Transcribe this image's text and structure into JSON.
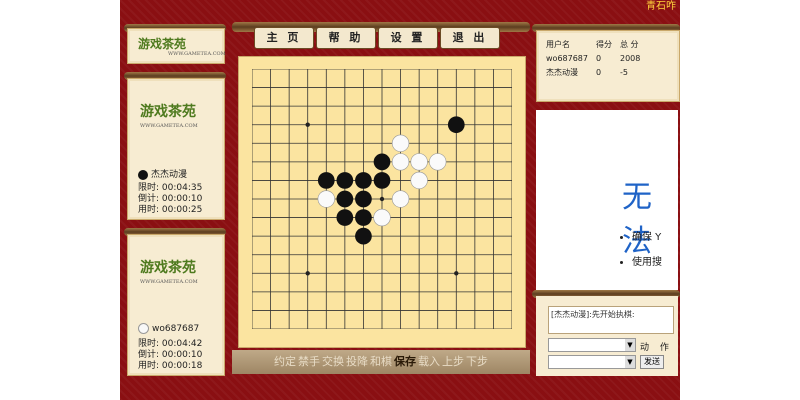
{
  "topbar": {
    "btn_label": "青石咋"
  },
  "menu": {
    "items": [
      "主 页",
      "帮 助",
      "设 置",
      "退 出"
    ]
  },
  "logo": {
    "text": "游戏茶苑",
    "sub": "WWW.GAMETEA.COM"
  },
  "players": [
    {
      "name": "杰杰动漫",
      "stone": "black",
      "limit_label": "限时:",
      "limit": "00:04:35",
      "count_label": "倒计:",
      "count": "00:00:10",
      "used_label": "用时:",
      "used": "00:00:25"
    },
    {
      "name": "wo687687",
      "stone": "white",
      "limit_label": "限时:",
      "limit": "00:04:42",
      "count_label": "倒计:",
      "count": "00:00:10",
      "used_label": "用时:",
      "used": "00:00:18"
    }
  ],
  "scores": {
    "headers": [
      "用户名",
      "得分",
      "总 分"
    ],
    "rows": [
      [
        "wo687687",
        "0",
        "2008"
      ],
      [
        "杰杰动漫",
        "0",
        "-5"
      ]
    ]
  },
  "ad": {
    "title": "无法",
    "items": [
      "确保 Y",
      "使用搜"
    ]
  },
  "chat": {
    "message": "[杰杰动漫]:先开始执棋:",
    "action_label": "动 作",
    "send_label": "发送"
  },
  "bottom": {
    "items": [
      "约定",
      "禁手",
      "交换",
      "投降",
      "和棋",
      "保存",
      "载入",
      "上步",
      "下步"
    ],
    "highlight": "保存"
  },
  "board": {
    "size": 15,
    "black": [
      [
        11,
        3
      ],
      [
        7,
        5
      ],
      [
        4,
        6
      ],
      [
        5,
        6
      ],
      [
        6,
        6
      ],
      [
        7,
        6
      ],
      [
        5,
        7
      ],
      [
        6,
        7
      ],
      [
        5,
        8
      ],
      [
        6,
        8
      ],
      [
        6,
        9
      ]
    ],
    "white": [
      [
        8,
        4
      ],
      [
        8,
        5
      ],
      [
        9,
        5
      ],
      [
        10,
        5
      ],
      [
        9,
        6
      ],
      [
        8,
        7
      ],
      [
        4,
        7
      ],
      [
        7,
        8
      ]
    ],
    "star_points": [
      [
        3,
        3
      ],
      [
        11,
        3
      ],
      [
        7,
        7
      ],
      [
        3,
        11
      ],
      [
        11,
        11
      ]
    ]
  },
  "colors": {
    "frame": "#8a0f12",
    "board": "#fbe4a0",
    "accent": "#1f63c7"
  }
}
